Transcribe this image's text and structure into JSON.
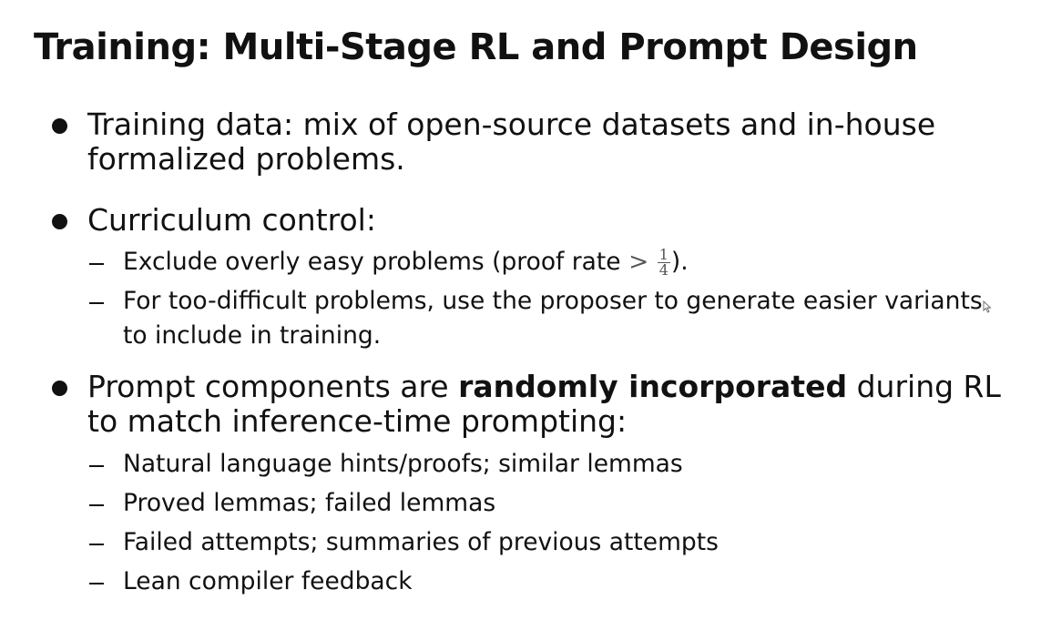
{
  "slide": {
    "title": "Training: Multi-Stage RL and Prompt Design",
    "bullets": [
      {
        "text": "Training data: mix of open-source datasets and in-house formalized problems."
      },
      {
        "text": "Curriculum control:",
        "subs": [
          {
            "text_before": "Exclude overly easy problems (proof rate",
            "math_operator": ">",
            "fraction_numerator": "1",
            "fraction_denominator": "4",
            "text_after": ")."
          },
          {
            "text": "For too-difficult problems, use the proposer to generate easier variants to include in training."
          }
        ]
      },
      {
        "text_before": "Prompt components are",
        "text_bold": "randomly incorporated",
        "text_after": "during RL to match inference-time prompting:",
        "subs": [
          {
            "text": "Natural language hints/proofs; similar lemmas"
          },
          {
            "text": "Proved lemmas; failed lemmas"
          },
          {
            "text": "Failed attempts; summaries of previous attempts"
          },
          {
            "text": "Lean compiler feedback"
          }
        ]
      }
    ]
  }
}
